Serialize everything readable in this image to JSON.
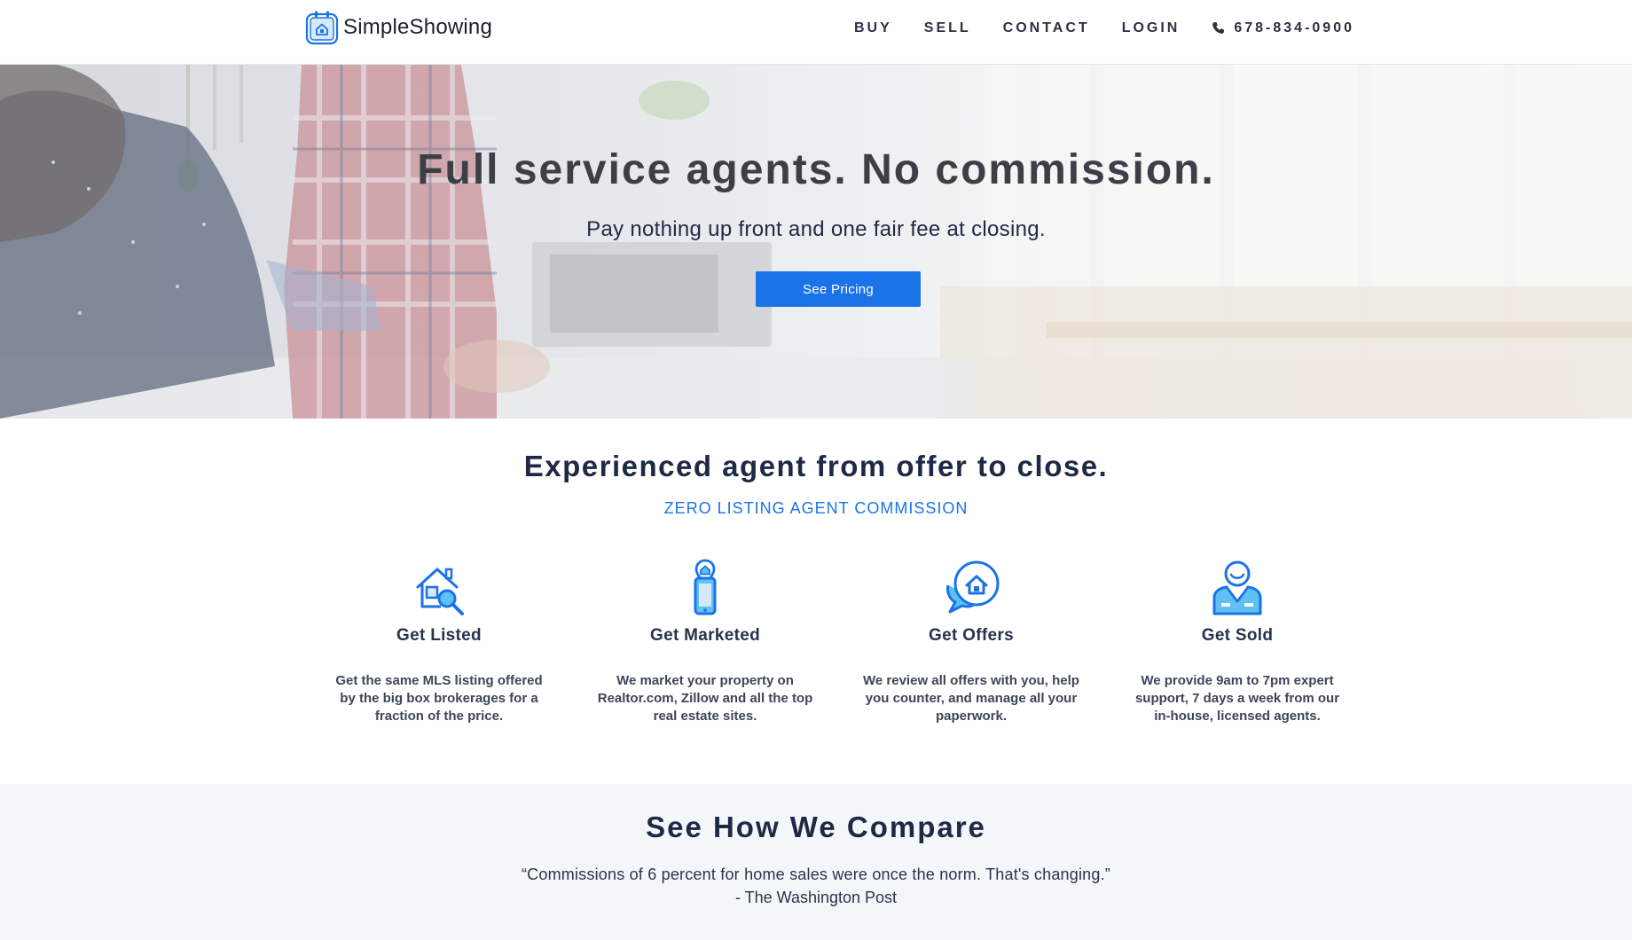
{
  "brand": {
    "name": "SimpleShowing",
    "logo_icon": "calendar-house-icon",
    "accent_color": "#1a73e8",
    "dark_text_color": "#1e2a45"
  },
  "nav": {
    "items": [
      "BUY",
      "SELL",
      "CONTACT",
      "LOGIN"
    ],
    "phone_icon": "phone-icon",
    "phone": "678-834-0900"
  },
  "hero": {
    "title": "Full service agents. No commission.",
    "subtitle": "Pay nothing up front and one fair fee at closing.",
    "cta_label": "See Pricing"
  },
  "features_section": {
    "title": "Experienced agent from offer to close.",
    "kicker": "ZERO LISTING AGENT COMMISSION",
    "items": [
      {
        "icon": "house-search-icon",
        "title": "Get Listed",
        "description": "Get the same MLS listing offered by the big box brokerages for a fraction of the price."
      },
      {
        "icon": "mobile-location-icon",
        "title": "Get Marketed",
        "description": "We market your property on Realtor.com, Zillow and all the top real estate sites."
      },
      {
        "icon": "chat-house-icon",
        "title": "Get Offers",
        "description": "We review all offers with you, help you counter, and manage all your paperwork."
      },
      {
        "icon": "agent-person-icon",
        "title": "Get Sold",
        "description": "We provide 9am to 7pm expert support, 7 days a week from our in-house, licensed agents."
      }
    ]
  },
  "compare": {
    "title": "See How We Compare",
    "quote": "“Commissions of 6 percent for home sales were once the norm. That's changing.”",
    "source": "- The Washington Post"
  }
}
